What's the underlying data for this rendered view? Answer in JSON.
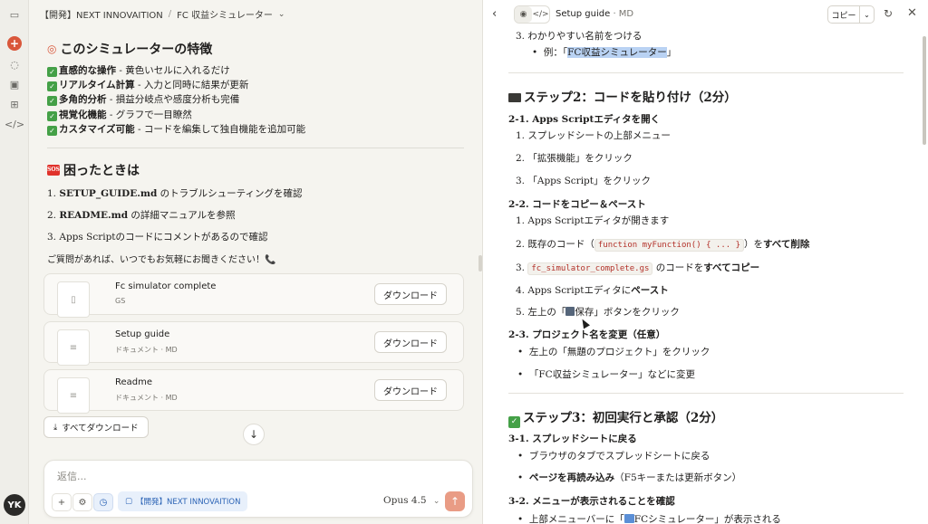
{
  "sidebar": {
    "avatar_initials": "YK"
  },
  "chat": {
    "breadcrumb": {
      "project": "【開発】NEXT INNOVAITION",
      "separator": "/",
      "title": "FC 収益シミュレーター"
    },
    "features": {
      "heading": "このシミュレーターの特徴",
      "items": [
        {
          "bold": "直感的な操作",
          "text": " - 黄色いセルに入れるだけ"
        },
        {
          "bold": "リアルタイム計算",
          "text": " - 入力と同時に結果が更新"
        },
        {
          "bold": "多角的分析",
          "text": " - 損益分岐点や感度分析も完備"
        },
        {
          "bold": "視覚化機能",
          "text": " - グラフで一目瞭然"
        },
        {
          "bold": "カスタマイズ可能",
          "text": " - コードを編集して独自機能を追加可能"
        }
      ]
    },
    "trouble": {
      "badge": "SOS",
      "heading": "困ったときは",
      "items": [
        {
          "num": "1.",
          "bold": "SETUP_GUIDE.md",
          "text": " のトラブルシューティングを確認"
        },
        {
          "num": "2.",
          "bold": "README.md",
          "text": " の詳細マニュアルを参照"
        },
        {
          "num": "3.",
          "bold": "",
          "text": "Apps Scriptのコードにコメントがあるので確認"
        }
      ],
      "note": "ご質問があれば、いつでもお気軽にお聞きください！📞"
    },
    "files": [
      {
        "name": "Fc simulator complete",
        "meta": "GS",
        "button": "ダウンロード"
      },
      {
        "name": "Setup guide",
        "meta": "ドキュメント · MD",
        "button": "ダウンロード"
      },
      {
        "name": "Readme",
        "meta": "ドキュメント · MD",
        "button": "ダウンロード"
      }
    ],
    "download_all": "すべてダウンロード",
    "composer": {
      "placeholder": "返信...",
      "project_chip": "【開発】NEXT INNOVAITION",
      "model": "Opus 4.5"
    }
  },
  "doc": {
    "title": "Setup guide",
    "meta": "· MD",
    "copy_label": "コピー",
    "lines": {
      "l1": "3. わかりやすい名前をつける",
      "l2_pre": "例：「",
      "l2_hl": "FC収益シミュレーター",
      "l2_post": "」",
      "step2": "ステップ2：コードを貼り付け（2分）",
      "s21": "2-1. Apps Scriptエディタを開く",
      "s21_1": "1. スプレッドシートの上部メニュー",
      "s21_2": "2. 「拡張機能」をクリック",
      "s21_3": "3. 「Apps Script」をクリック",
      "s22": "2-2. コードをコピー＆ペースト",
      "s22_1": "1. Apps Scriptエディタが開きます",
      "s22_2_pre": "2. 既存のコード（",
      "s22_2_code": "function myFunction() { ... }",
      "s22_2_mid": "）を",
      "s22_2_bold": "すべて削除",
      "s22_3_pre": "3. ",
      "s22_3_code": "fc_simulator_complete.gs",
      "s22_3_mid": " のコードを",
      "s22_3_bold": "すべてコピー",
      "s22_4_pre": "4. Apps Scriptエディタに",
      "s22_4_bold": "ペースト",
      "s22_5_pre": "5. 左上の「",
      "s22_5_post": "保存」ボタンをクリック",
      "s23": "2-3. プロジェクト名を変更（任意）",
      "s23_1": "左上の「無題のプロジェクト」をクリック",
      "s23_2": "「FC収益シミュレーター」などに変更",
      "step3": "ステップ3：初回実行と承認（2分）",
      "s31": "3-1. スプレッドシートに戻る",
      "s31_1": "ブラウザのタブでスプレッドシートに戻る",
      "s31_2_bold": "ページを再読み込み",
      "s31_2_post": "（F5キーまたは更新ボタン）",
      "s32": "3-2. メニューが表示されることを確認",
      "s32_1_pre": "上部メニューバーに「",
      "s32_1_post": "FCシミュレーター」が表示される"
    }
  }
}
